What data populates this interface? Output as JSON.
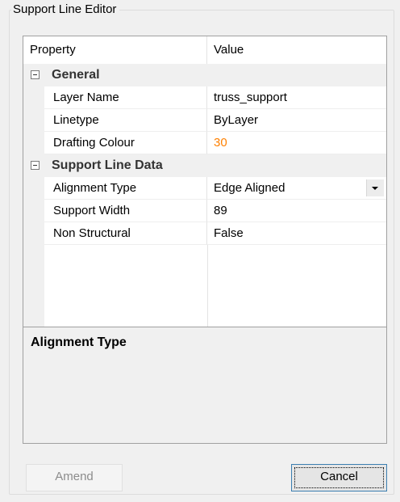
{
  "group": {
    "title": "Support Line Editor"
  },
  "grid": {
    "headers": {
      "property": "Property",
      "value": "Value"
    },
    "categories": [
      {
        "label": "General",
        "rows": [
          {
            "name": "Layer Name",
            "value": "truss_support"
          },
          {
            "name": "Linetype",
            "value": "ByLayer"
          },
          {
            "name": "Drafting Colour",
            "value": "30"
          }
        ]
      },
      {
        "label": "Support Line Data",
        "rows": [
          {
            "name": "Alignment Type",
            "value": "Edge Aligned"
          },
          {
            "name": "Support Width",
            "value": "89"
          },
          {
            "name": "Non Structural",
            "value": "False"
          }
        ]
      }
    ],
    "help_title": "Alignment Type"
  },
  "buttons": {
    "amend": "Amend",
    "cancel": "Cancel"
  },
  "colors": {
    "drafting_colour_value": "#ff8000"
  }
}
